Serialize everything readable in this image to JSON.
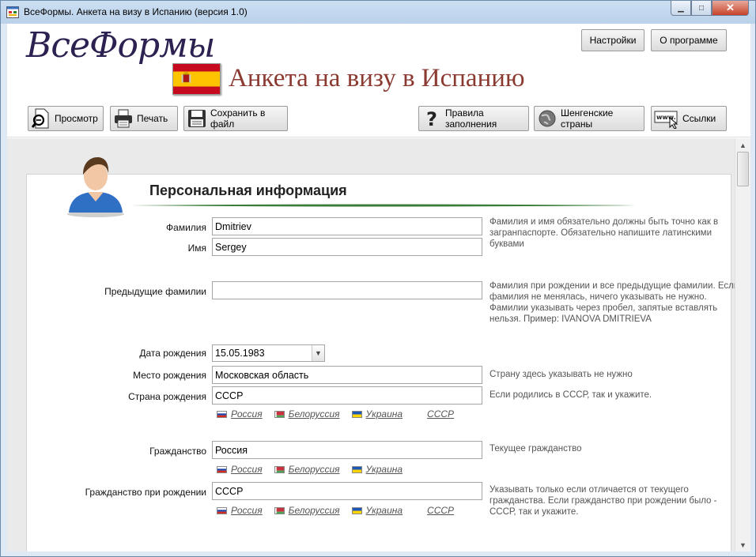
{
  "window": {
    "title": "ВсеФормы. Анкета на визу в Испанию (версия 1.0)"
  },
  "header": {
    "logo": "ВсеФормы",
    "form_title": "Анкета на визу в Испанию",
    "settings_label": "Настройки",
    "about_label": "О программе"
  },
  "toolbar": {
    "preview_label": "Просмотр",
    "print_label": "Печать",
    "save_label": "Сохранить в файл",
    "rules_label": "Правила заполнения",
    "schengen_label": "Шенгенские страны",
    "links_label": "Ссылки"
  },
  "section": {
    "title": "Персональная информация"
  },
  "fields": {
    "surname": {
      "label": "Фамилия",
      "value": "Dmitriev"
    },
    "name": {
      "label": "Имя",
      "value": "Sergey"
    },
    "name_hint": "Фамилия и имя обязательно должны быть точно как в загранпаспорте. Обязательно напишите латинскими буквами",
    "prev_surnames": {
      "label": "Предыдущие фамилии",
      "value": "",
      "hint": "Фамилия при рождении и все предыдущие фамилии. Если фамилия не менялась, ничего указывать не нужно. Фамилии указывать через пробел, запятые вставлять нельзя. Пример: IVANOVA DMITRIEVA"
    },
    "birth_date": {
      "label": "Дата рождения",
      "value": "15.05.1983"
    },
    "birth_place": {
      "label": "Место рождения",
      "value": "Московская область",
      "hint": "Страну здесь указывать не нужно"
    },
    "birth_country": {
      "label": "Страна рождения",
      "value": "СССР",
      "hint": "Если родились в СССР, так и укажите."
    },
    "citizenship": {
      "label": "Гражданство",
      "value": "Россия",
      "hint": "Текущее гражданство"
    },
    "birth_citizenship": {
      "label": "Гражданство при рождении",
      "value": "СССР",
      "hint": "Указывать только если отличается от текущего гражданства. Если гражданство при рождении было - СССР, так и укажите."
    }
  },
  "quick": {
    "russia": "Россия",
    "belarus": "Белоруссия",
    "ukraine": "Украина",
    "ussr": "СССР"
  },
  "colors": {
    "title_red": "#8b3a32",
    "logo_navy": "#2c2150",
    "section_line": "#3a7d3a"
  }
}
